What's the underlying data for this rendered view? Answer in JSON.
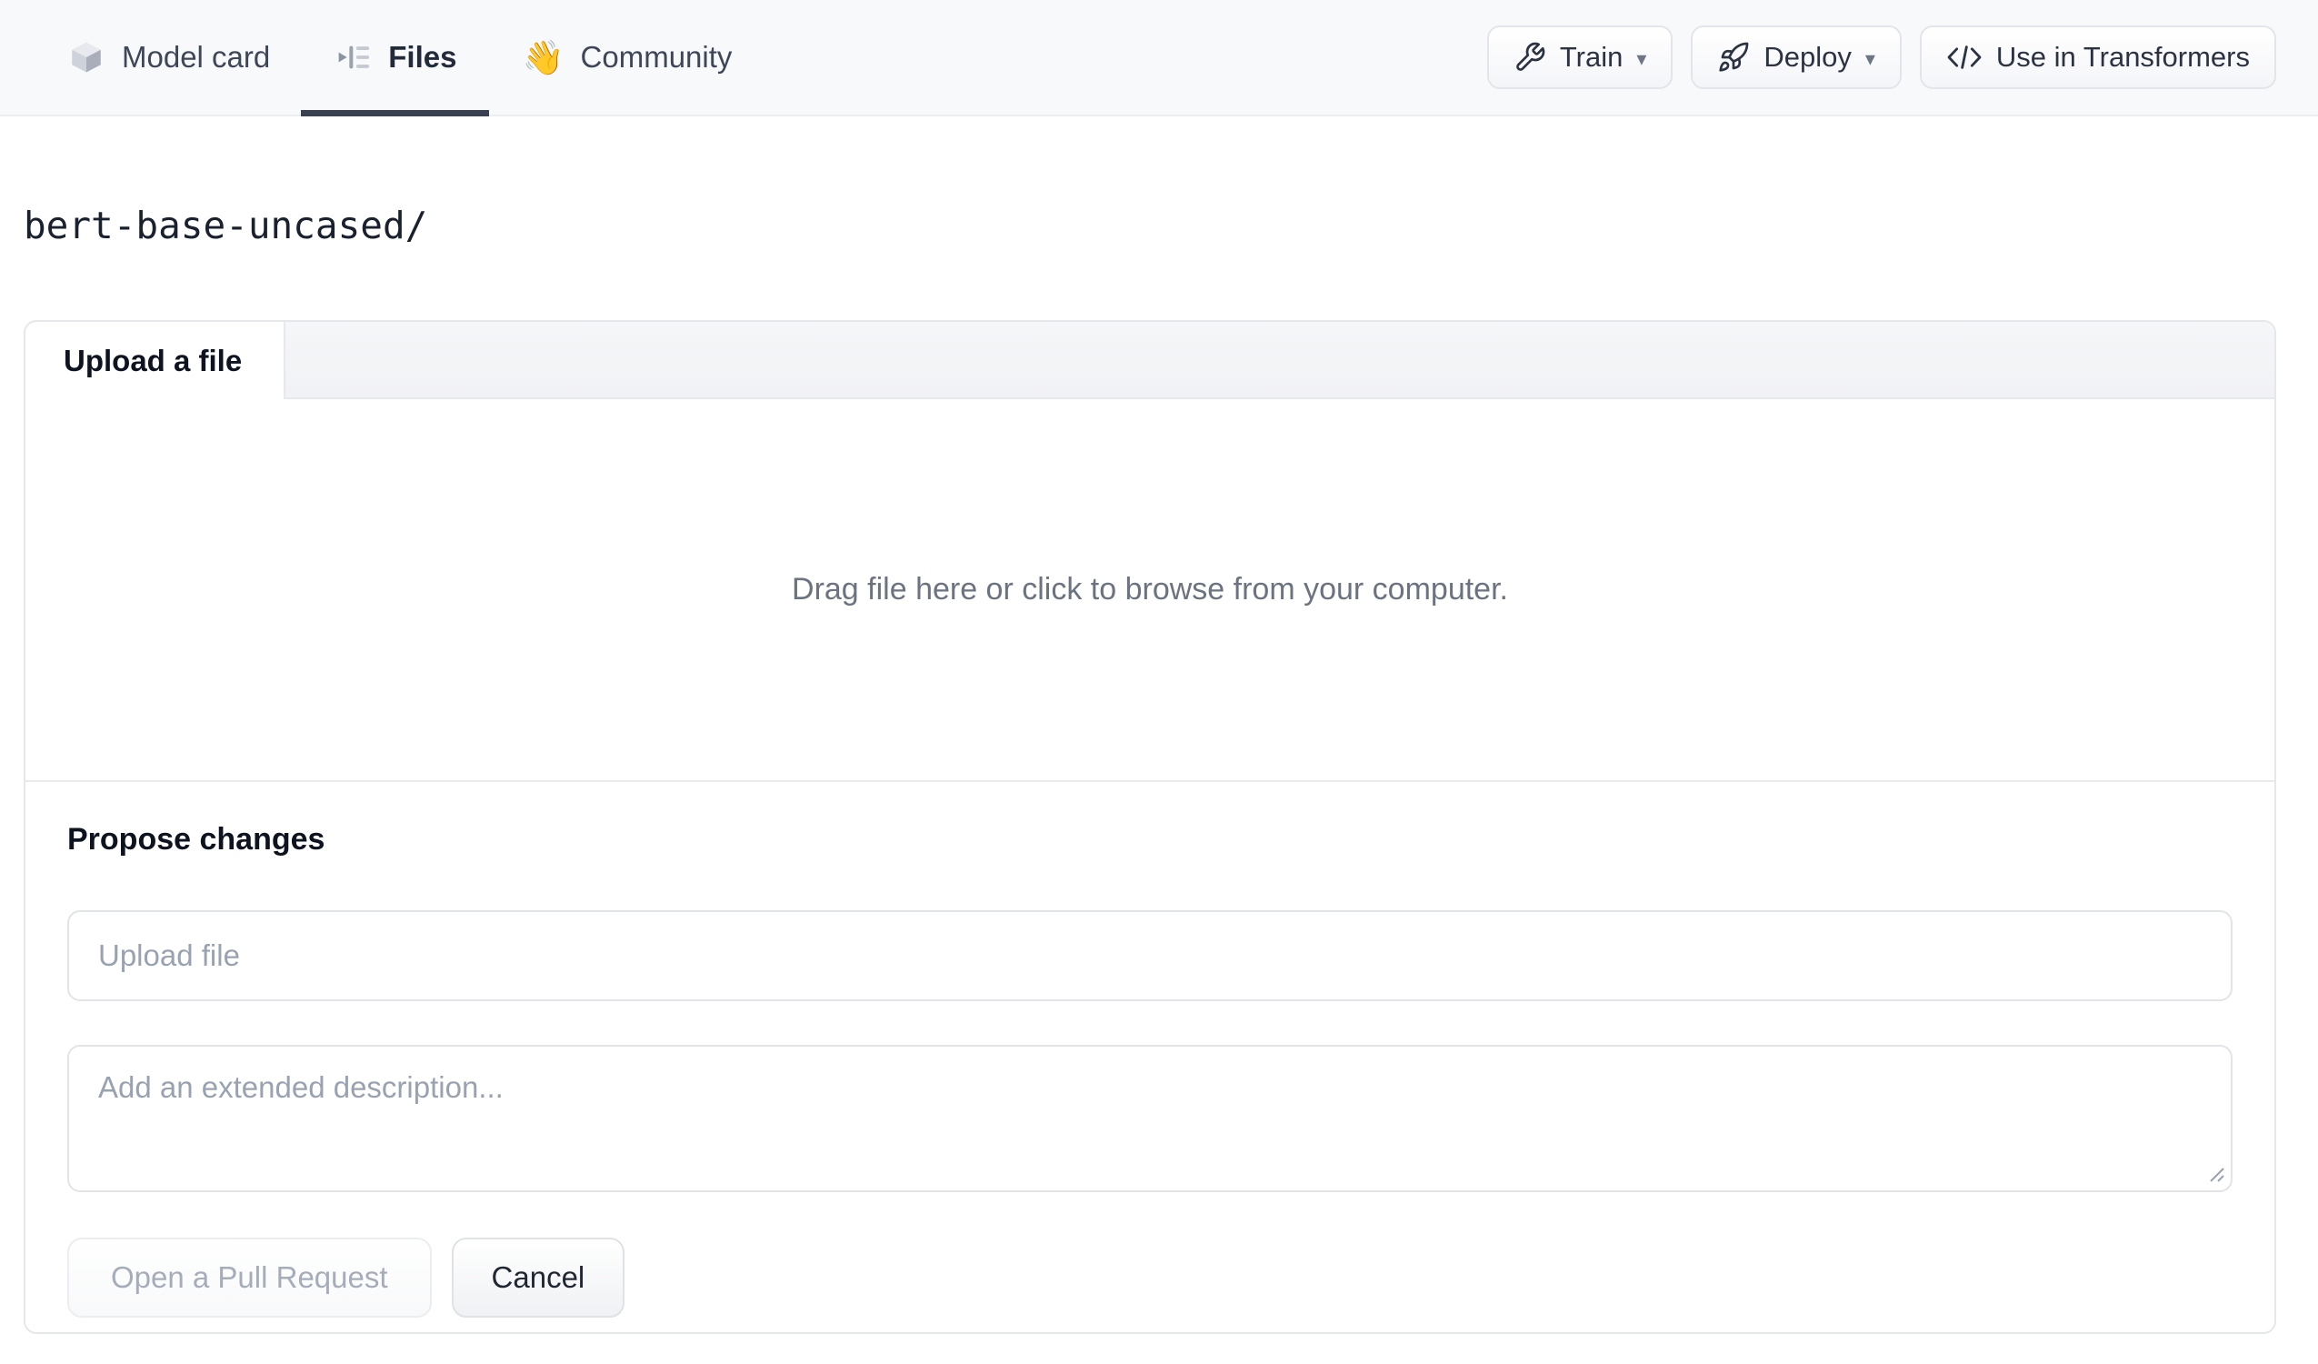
{
  "topbar": {
    "tabs": [
      {
        "label": "Model card",
        "icon": "cube-icon",
        "active": false
      },
      {
        "label": "Files",
        "icon": "versions-list-icon",
        "active": true
      },
      {
        "label": "Community",
        "icon": "waving-hand-icon",
        "active": false
      }
    ],
    "actions": [
      {
        "label": "Train",
        "icon": "wrench-icon",
        "has_dropdown": true
      },
      {
        "label": "Deploy",
        "icon": "rocket-icon",
        "has_dropdown": true
      },
      {
        "label": "Use in Transformers",
        "icon": "code-icon",
        "has_dropdown": false
      }
    ]
  },
  "icons": {
    "waving_hand": "👋",
    "dropdown_caret": "▾"
  },
  "breadcrumb": {
    "path": "bert-base-uncased/"
  },
  "upload_card": {
    "tab_label": "Upload a file",
    "dropzone_text": "Drag file here or click to browse from your computer.",
    "propose_heading": "Propose changes",
    "file_name_placeholder": "Upload file",
    "description_placeholder": "Add an extended description...",
    "pull_request_button": "Open a Pull Request",
    "cancel_button": "Cancel"
  },
  "colors": {
    "topbar_bg": "#f8f9fb",
    "topbar_border": "#eceef1",
    "tab_text": "#3e4757",
    "tab_active_text": "#222b3a",
    "tab_underline": "#394150",
    "button_text": "#2b3342",
    "button_border": "#e3e5ea",
    "card_border": "#e5e7eb",
    "dropzone_text": "#6b7280",
    "placeholder_text": "#99a2b0",
    "disabled_button_text": "#a6adba"
  }
}
